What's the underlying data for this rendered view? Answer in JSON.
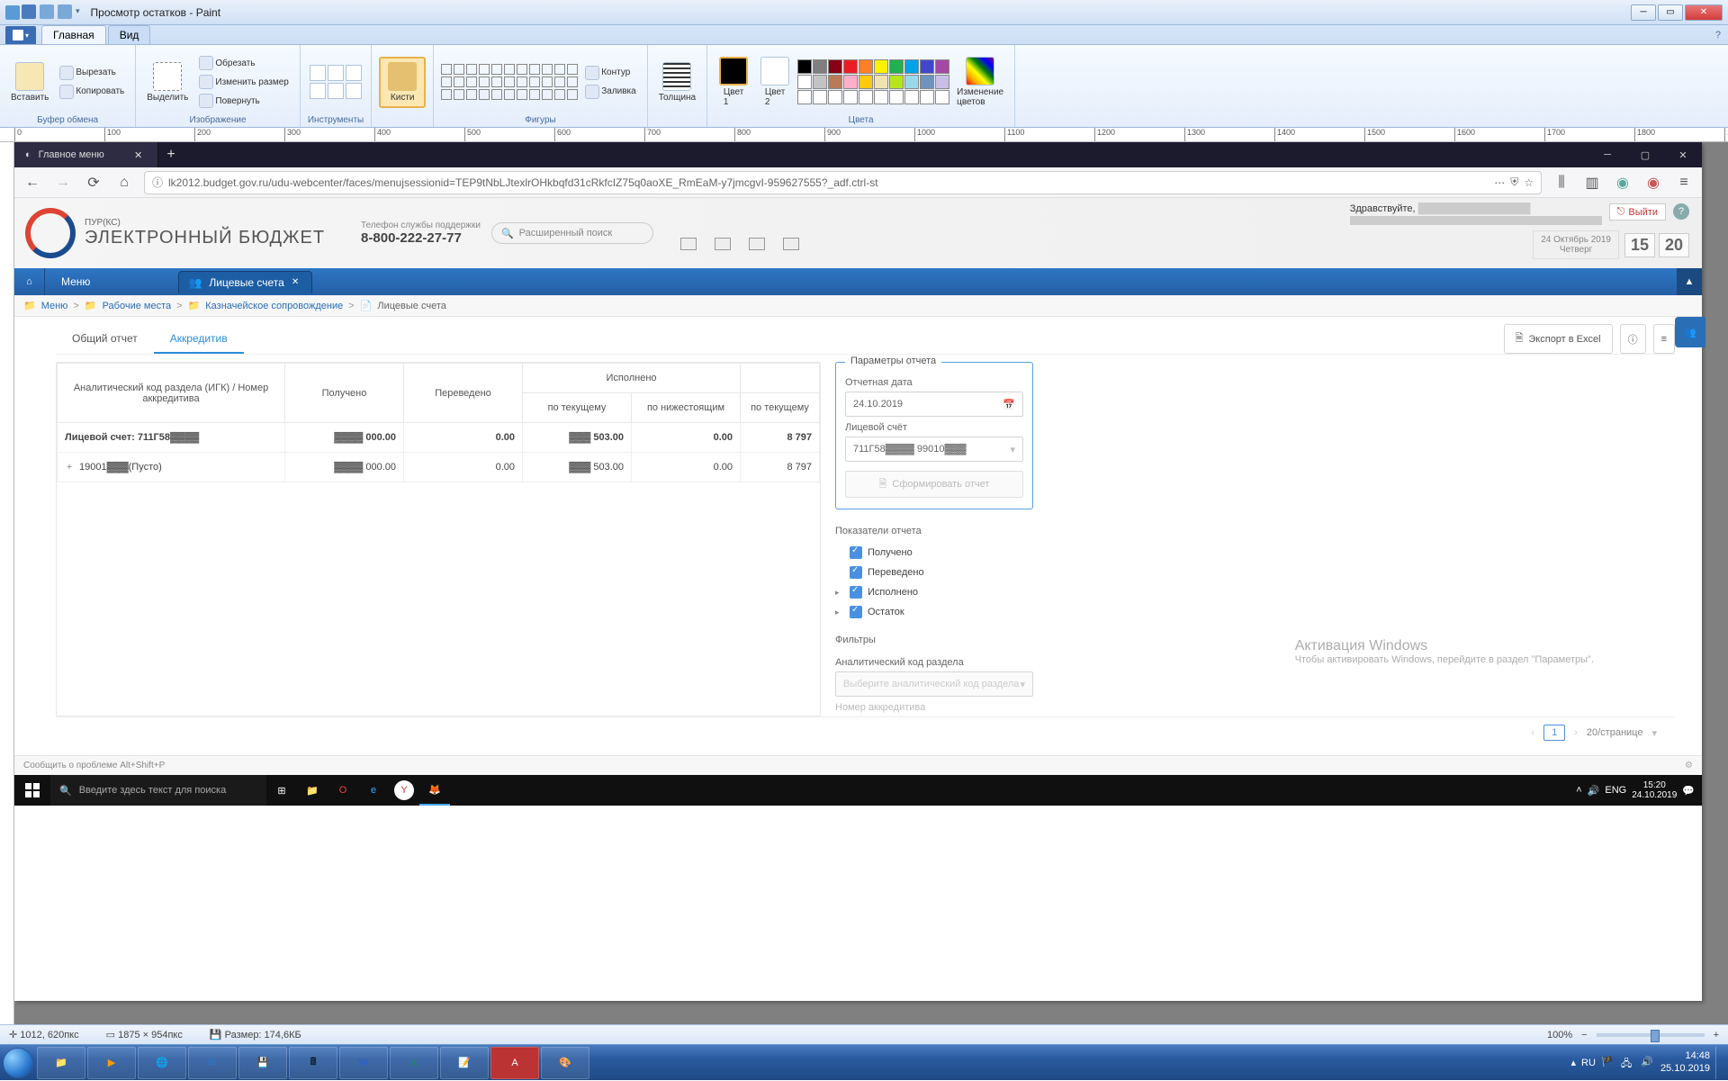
{
  "win_title": "Просмотр остатков - Paint",
  "paint_tabs": {
    "home": "Главная",
    "view": "Вид"
  },
  "ribbon": {
    "clipboard": {
      "paste": "Вставить",
      "cut": "Вырезать",
      "copy": "Копировать",
      "group": "Буфер обмена"
    },
    "image": {
      "select": "Выделить",
      "crop": "Обрезать",
      "resize": "Изменить размер",
      "rotate": "Повернуть",
      "group": "Изображение"
    },
    "tools": {
      "group": "Инструменты"
    },
    "brushes": {
      "label": "Кисти"
    },
    "shapes": {
      "outline": "Контур",
      "fill": "Заливка",
      "group": "Фигуры"
    },
    "stroke": {
      "label": "Толщина"
    },
    "color1": {
      "label": "Цвет\n1"
    },
    "color2": {
      "label": "Цвет\n2"
    },
    "colors": {
      "group": "Цвета",
      "edit": "Изменение\nцветов"
    }
  },
  "browser": {
    "tab": "Главное меню",
    "url": "lk2012.budget.gov.ru/udu-webcenter/faces/menujsessionid=TEP9tNbLJtexlrOHkbqfd31cRkfcIZ75q0aoXE_RmEaM-y7jmcgvI-959627555?_adf.ctrl-st"
  },
  "site": {
    "logo_sub": "ПУР(КС)",
    "logo_main": "ЭЛЕКТРОННЫЙ БЮДЖЕТ",
    "support_label": "Телефон службы поддержки",
    "support_phone": "8-800-222-27-77",
    "adv_search": "Расширенный поиск",
    "greeting": "Здравствуйте,",
    "exit": "Выйти",
    "date": "24 Октябрь 2019",
    "day": "Четверг",
    "time_h": "15",
    "time_m": "20",
    "nav_menu": "Меню",
    "nav_tab": "Лицевые счета",
    "bc": [
      "Меню",
      "Рабочие места",
      "Казначейское сопровождение",
      "Лицевые счета"
    ],
    "ctab1": "Общий отчет",
    "ctab2": "Аккредитив",
    "export": "Экспорт в Excel",
    "headers": {
      "code": "Аналитический код раздела (ИГК) / Номер аккредитива",
      "received": "Получено",
      "transferred": "Переведено",
      "executed": "Исполнено",
      "exec_current": "по текущему",
      "exec_lower": "по нижестоящим",
      "balance_current": "по текущему"
    },
    "rows": [
      {
        "label": "Лицевой счет: 711Г58▓▓▓▓",
        "received": "▓▓▓▓ 000.00",
        "transferred": "0.00",
        "exec_cur": "▓▓▓ 503.00",
        "exec_low": "0.00",
        "bal": "8 797",
        "bold": true
      },
      {
        "label": "19001▓▓▓(Пусто)",
        "received": "▓▓▓▓ 000.00",
        "transferred": "0.00",
        "exec_cur": "▓▓▓ 503.00",
        "exec_low": "0.00",
        "bal": "8 797",
        "expand": "+"
      }
    ],
    "params_title": "Параметры отчета",
    "date_label": "Отчетная дата",
    "date_value": "24.10.2019",
    "account_label": "Лицевой счёт",
    "account_value": "711Г58▓▓▓▓ 99010▓▓▓",
    "gen_btn": "Сформировать отчет",
    "indicators_title": "Показатели отчета",
    "ind1": "Получено",
    "ind2": "Переведено",
    "ind3": "Исполнено",
    "ind4": "Остаток",
    "filters_title": "Фильтры",
    "filter1": "Аналитический код раздела",
    "filter1_ph": "Выберите аналитический код раздела",
    "filter2": "Номер аккредитива",
    "pager_page": "1",
    "pager_size": "20/странице",
    "watermark1": "Активация Windows",
    "watermark2": "Чтобы активировать Windows, перейдите в раздел \"Параметры\".",
    "footer_hint": "Сообщить о проблеме Alt+Shift+P"
  },
  "inner_tb": {
    "search": "Введите здесь текст для поиска",
    "lang": "ENG",
    "time": "15:20",
    "date": "24.10.2019"
  },
  "status": {
    "pos": "1012, 620пкс",
    "dim": "1875 × 954пкс",
    "size": "Размер: 174,6КБ",
    "zoom": "100%"
  },
  "outer_tb": {
    "lang": "RU",
    "time": "14:48",
    "date": "25.10.2019"
  }
}
